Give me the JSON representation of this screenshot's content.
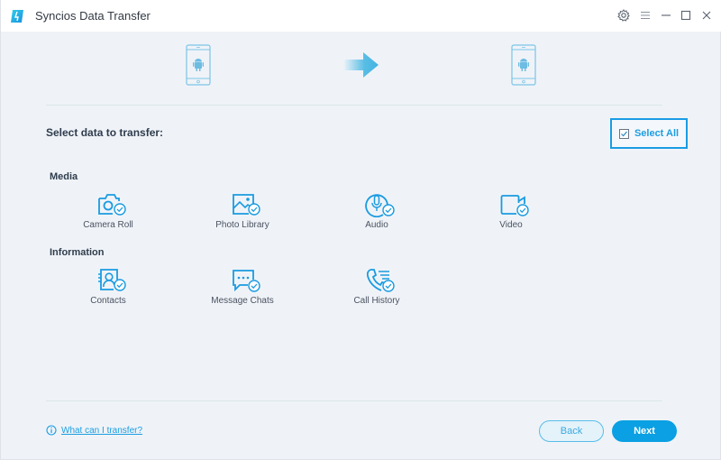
{
  "window": {
    "title": "Syncios Data Transfer",
    "controls": [
      "settings-icon",
      "menu-icon",
      "minimize-icon",
      "maximize-icon",
      "close-icon"
    ]
  },
  "hero": {
    "source_device": "android-phone",
    "target_device": "android-phone",
    "direction_icon": "arrow-right"
  },
  "selection": {
    "title": "Select data to transfer:",
    "select_all_label": "Select All",
    "select_all_checked": true
  },
  "groups": [
    {
      "title": "Media",
      "items": [
        {
          "label": "Camera Roll",
          "icon": "camera-icon",
          "checked": true
        },
        {
          "label": "Photo Library",
          "icon": "photo-icon",
          "checked": true
        },
        {
          "label": "Audio",
          "icon": "microphone-icon",
          "checked": true
        },
        {
          "label": "Video",
          "icon": "video-icon",
          "checked": true
        }
      ]
    },
    {
      "title": "Information",
      "items": [
        {
          "label": "Contacts",
          "icon": "contacts-icon",
          "checked": true
        },
        {
          "label": "Message Chats",
          "icon": "chat-icon",
          "checked": true
        },
        {
          "label": "Call History",
          "icon": "phone-call-icon",
          "checked": true
        }
      ]
    }
  ],
  "footer": {
    "help_link": "What can I transfer?",
    "back_label": "Back",
    "next_label": "Next"
  },
  "colors": {
    "accent": "#1d9de0",
    "primary_button": "#0aa0e3",
    "background": "#eff3f8"
  }
}
